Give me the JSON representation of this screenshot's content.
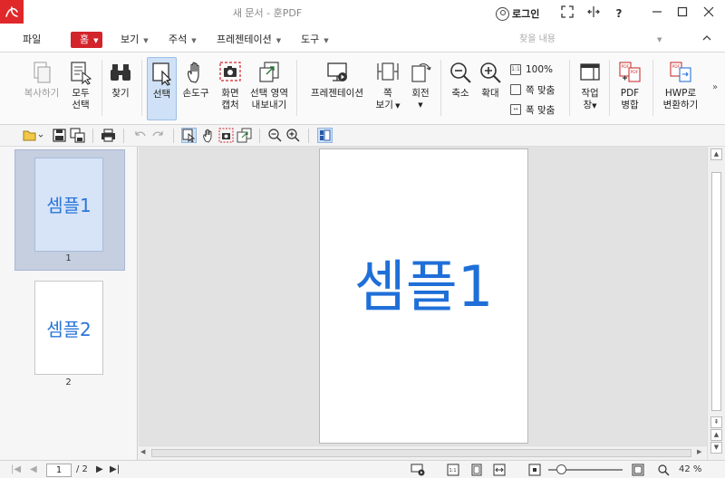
{
  "window": {
    "title": "새 문서 - 훈PDF",
    "login_label": "로그인",
    "help_label": "?"
  },
  "menu": {
    "file": "파일",
    "home": "홈",
    "view": "보기",
    "annotate": "주석",
    "presentation": "프레젠테이션",
    "tools": "도구",
    "search_placeholder": "찾을 내용"
  },
  "ribbon": {
    "copy": "복사하기",
    "select_all_1": "모두",
    "select_all_2": "선택",
    "find": "찾기",
    "select": "선택",
    "hand": "손도구",
    "capture_1": "화면",
    "capture_2": "캡처",
    "export_1": "선택 영역",
    "export_2": "내보내기",
    "present": "프레젠테이션",
    "fit_view_1": "쪽",
    "fit_view_2": "보기",
    "rotate_1": "회전",
    "zoom_out": "축소",
    "zoom_in": "확대",
    "zoom_100": "100%",
    "fit_page": "쪽 맞춤",
    "fit_width": "폭 맞춤",
    "window_1": "작업",
    "window_2": "창",
    "pdf_merge_1": "PDF",
    "pdf_merge_2": "병합",
    "hwp_1": "HWP로",
    "hwp_2": "변환하기"
  },
  "thumbnails": [
    {
      "text": "셈플1",
      "number": "1",
      "selected": true
    },
    {
      "text": "셈플2",
      "number": "2",
      "selected": false
    }
  ],
  "document": {
    "text": "셈플1"
  },
  "status": {
    "current_page": "1",
    "total_pages": "/ 2",
    "zoom": "42 %"
  },
  "colors": {
    "brand_red": "#d3242b",
    "sample_text_blue": "#1f6fd8",
    "selection_blue": "#cfe1f6"
  }
}
